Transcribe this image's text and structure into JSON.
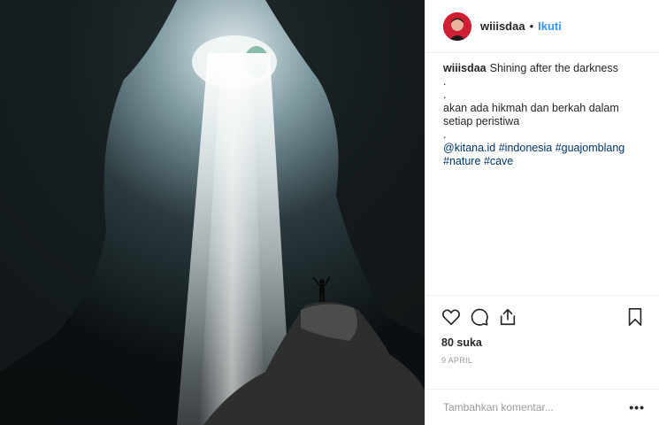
{
  "post": {
    "image": {
      "subject": "cave-light-beam-photo"
    },
    "header": {
      "username": "wiiisdaa",
      "separator": "•",
      "follow_label": "Ikuti"
    },
    "caption": {
      "username": "wiiisdaa",
      "text": "Shining after the darkness",
      "dot1": ".",
      "dot2": ".",
      "line2": "akan ada hikmah dan berkah dalam setiap peristiwa",
      "dot3": ".",
      "tags": [
        "@kitana.id",
        "#indonesia",
        "#guajomblang",
        "#nature",
        "#cave"
      ]
    },
    "actions": {
      "icons": [
        "heart-icon",
        "comment-icon",
        "share-icon",
        "bookmark-icon"
      ]
    },
    "likes": "80 suka",
    "date": "9 APRIL",
    "comment_placeholder": "Tambahkan komentar...",
    "more_label": "•••"
  },
  "colors": {
    "link": "#3897f0",
    "hashtag": "#003569",
    "muted": "#999999",
    "text": "#262626"
  }
}
